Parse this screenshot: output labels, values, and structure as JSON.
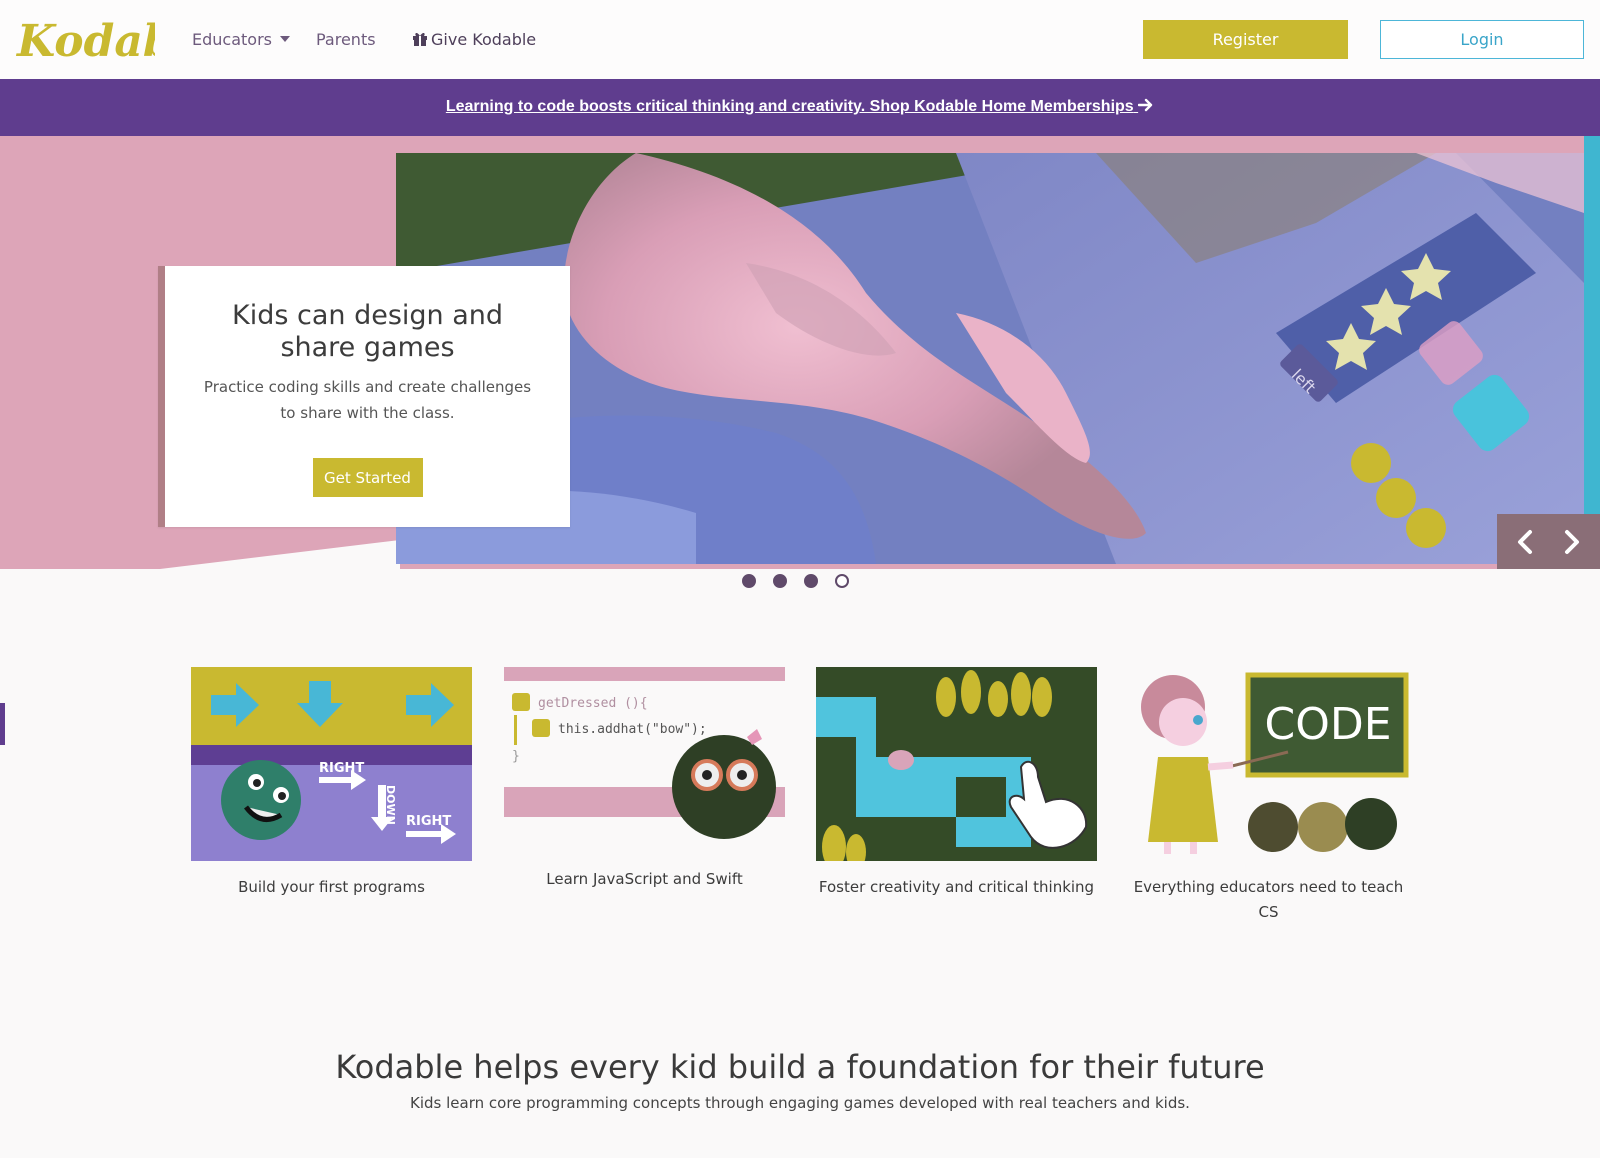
{
  "nav": {
    "logo_text": "Kodable",
    "educators": "Educators",
    "parents": "Parents",
    "give": "Give Kodable",
    "register": "Register",
    "login": "Login"
  },
  "promo": {
    "text": "Learning to code boosts critical thinking and creativity. Shop Kodable Home Memberships"
  },
  "hero": {
    "title": "Kids can design and share games",
    "body": "Practice coding skills and create challenges to share with the class.",
    "cta": "Get Started",
    "photo_labels": {
      "left": "left"
    },
    "active_slide": 4,
    "slide_count": 4
  },
  "features": [
    {
      "caption": "Build your first programs",
      "labels": [
        "RIGHT",
        "DOWN",
        "RIGHT"
      ]
    },
    {
      "caption": "Learn JavaScript and Swift",
      "code1": "getDressed (){",
      "code2": "this.addhat(\"bow\");",
      "code3": "}"
    },
    {
      "caption": "Foster creativity and critical thinking"
    },
    {
      "caption": "Everything educators need to teach CS",
      "board": "CODE"
    }
  ],
  "tagline": {
    "title": "Kodable helps every kid build a foundation for their future",
    "subtitle": "Kids learn core programming concepts through engaging games developed with real teachers and kids."
  },
  "colors": {
    "brand_yellow": "#c9b930",
    "promo_purple": "#5f3d8e",
    "hero_pink": "#dda5b8",
    "login_blue": "#4db6d8"
  }
}
